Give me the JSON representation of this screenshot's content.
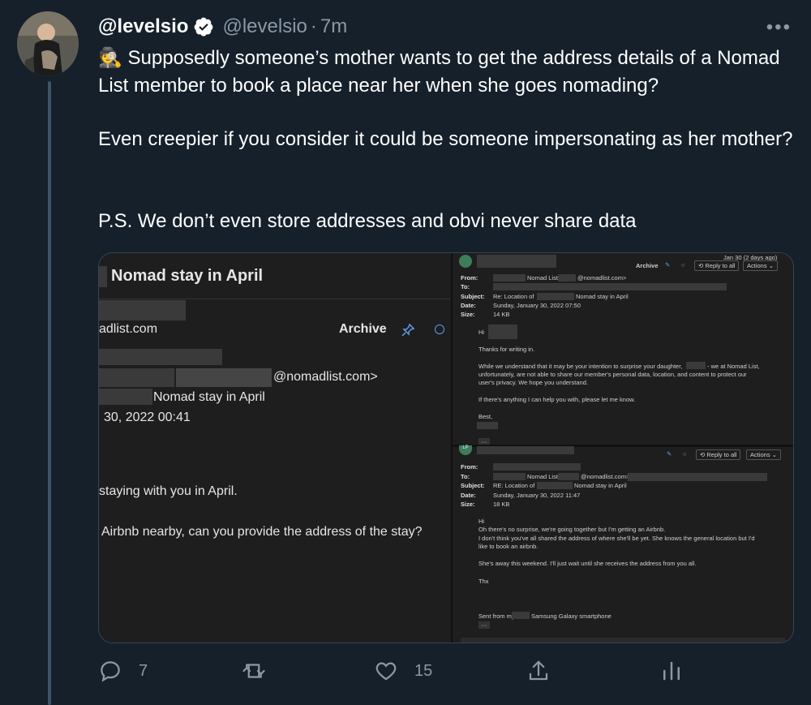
{
  "tweet": {
    "display_name": "@levelsio",
    "handle": "@levelsio",
    "separator": "·",
    "time": "7m",
    "paragraphs": [
      "🕵️ Supposedly someone’s mother wants to get the address details of a Nomad List member to book a place near her when she goes nomading?",
      "Even creepier if you consider it could be someone impersonating as her mother?",
      "P.S. We don’t even store addresses and obvi never share data"
    ]
  },
  "left_email": {
    "subject_title": "Nomad stay in April",
    "domain_frag": "adlist.com",
    "archive_label": "Archive",
    "to_frag": "@nomadlist.com>",
    "subject_frag": "Nomad stay in April",
    "date_frag": "30, 2022 00:41",
    "body1": "staying with you in April.",
    "body2": "Airbnb nearby, can you provide the address of the stay?"
  },
  "right_top": {
    "date_ago": "Jan 30 (2 days ago)",
    "archive": "Archive",
    "reply_all": "Reply to all",
    "actions": "Actions",
    "from_label": "From:",
    "from_val": "Nomad List",
    "from_email": "@nomadlist.com>",
    "to_label": "To:",
    "subject_label": "Subject:",
    "subject_val": "Re: Location of",
    "subject_val2": "Nomad stay in April",
    "date_label": "Date:",
    "date_val": "Sunday, January 30, 2022 07:50",
    "size_label": "Size:",
    "size_val": "14 KB",
    "greeting": "Hi",
    "line1": "Thanks for writing in.",
    "line2a": "While we understand that it may be your intention to surprise your daughter,",
    "line2b": "- we at Nomad List,",
    "line3": "unfortunately, are not able to share our member's personal data, location, and content to protect our",
    "line4": "user's privacy. We hope you understand.",
    "line5": "If there's anything I can help you with, please let me know.",
    "signoff": "Best,",
    "ellipsis": "···"
  },
  "right_bottom": {
    "avatar_initials": "LP",
    "reply_all": "Reply to all",
    "actions": "Actions",
    "from_label": "From:",
    "to_label": "To:",
    "to_val": "Nomad List",
    "to_email": "@nomadlist.com>",
    "subject_label": "Subject:",
    "subject_val": "RE: Location of",
    "subject_val2": "Nomad stay in April",
    "date_label": "Date:",
    "date_val": "Sunday, January 30, 2022 11:47",
    "size_label": "Size:",
    "size_val": "18 KB",
    "greeting": "Hi",
    "line1": "Oh there's no surprise,  we're going together but I'm getting an Airbnb.",
    "line2": "I don't think you've all shared the address of where she'll be yet. She knows the general location but I'd",
    "line3": "like to book an airbnb.",
    "line4": "She's away this weekend.  I'll just wait until she receives the address from you all.",
    "thx": "Thx",
    "sent_a": "Sent from my",
    "sent_b": "Samsung Galaxy smartphone",
    "ellipsis": "···"
  },
  "actions": {
    "reply_count": "7",
    "retweet_count": "",
    "like_count": "15"
  },
  "icons": [
    "verified-badge-icon",
    "more-icon",
    "reply-icon",
    "retweet-icon",
    "like-icon",
    "share-icon",
    "analytics-icon",
    "pin-icon",
    "circle-icon"
  ],
  "colors": {
    "background": "#15202b",
    "muted": "#8b98a5",
    "thread_line": "#3d5466"
  }
}
